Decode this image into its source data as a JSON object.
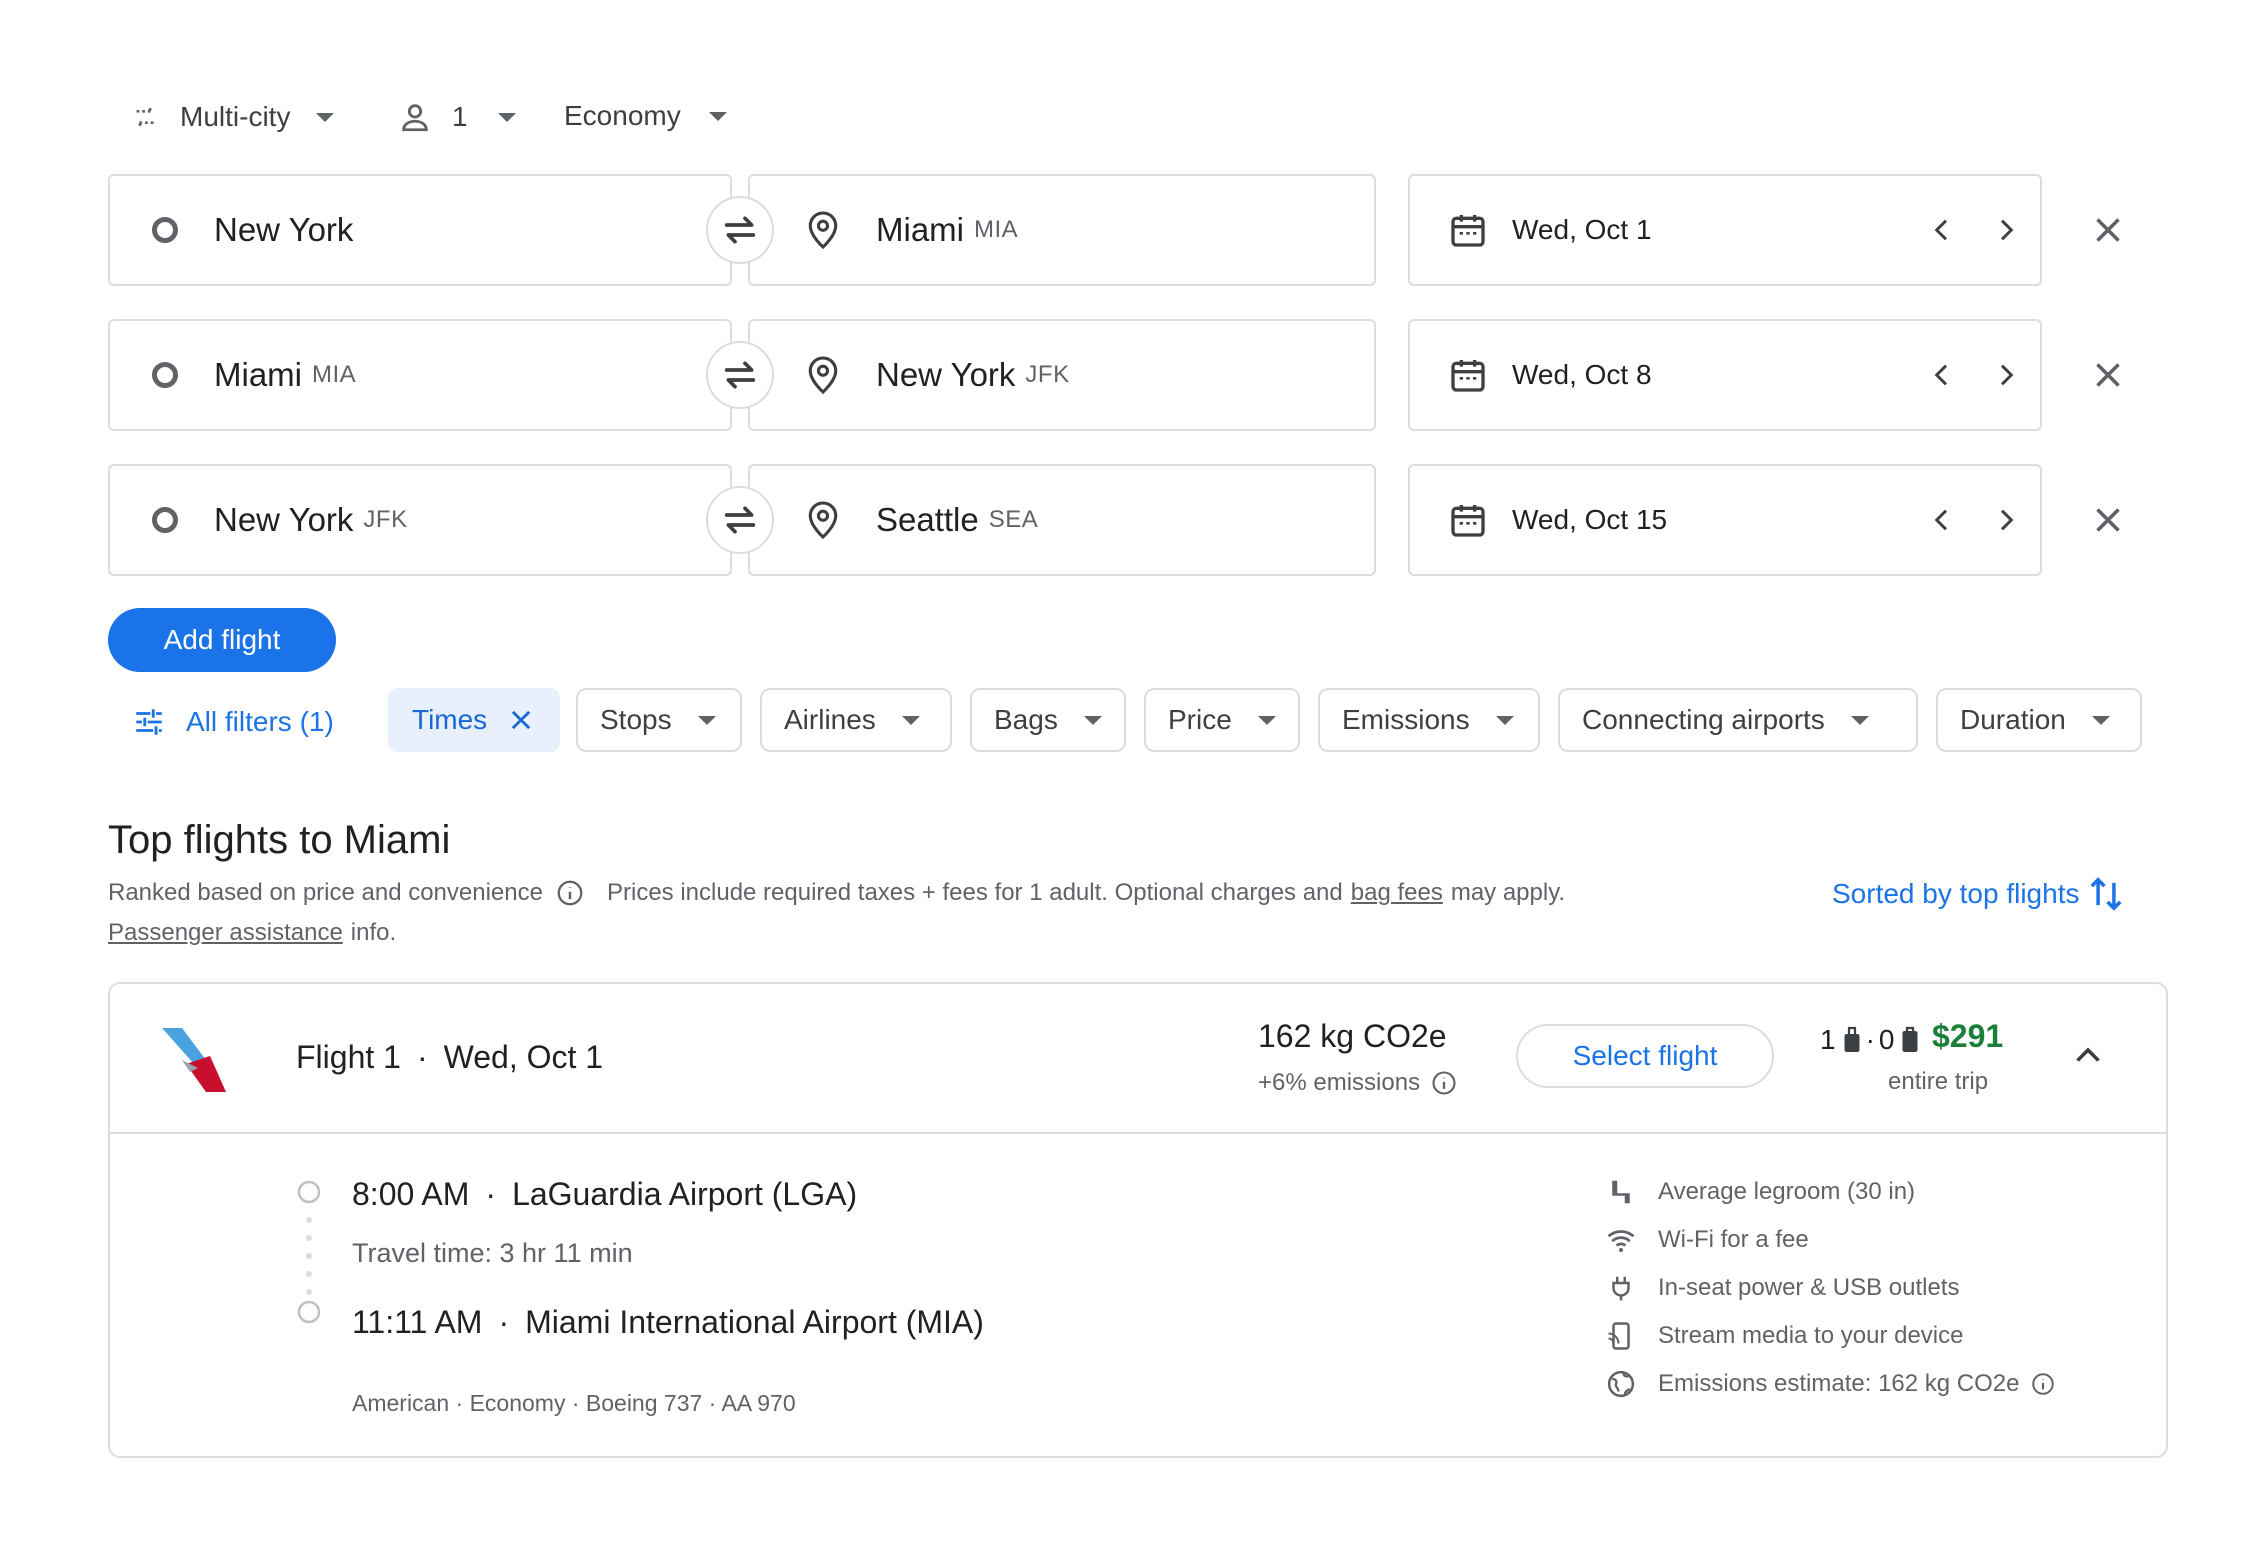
{
  "trip": {
    "type_label": "Multi-city",
    "passengers": "1",
    "cabin": "Economy"
  },
  "legs": [
    {
      "from_city": "New York",
      "from_code": "",
      "to_city": "Miami",
      "to_code": "MIA",
      "date": "Wed, Oct 1"
    },
    {
      "from_city": "Miami",
      "from_code": "MIA",
      "to_city": "New York",
      "to_code": "JFK",
      "date": "Wed, Oct 8"
    },
    {
      "from_city": "New York",
      "from_code": "JFK",
      "to_city": "Seattle",
      "to_code": "SEA",
      "date": "Wed, Oct 15"
    }
  ],
  "add_flight_label": "Add flight",
  "filters": {
    "all_label": "All filters (1)",
    "chips": [
      "Times",
      "Stops",
      "Airlines",
      "Bags",
      "Price",
      "Emissions",
      "Connecting airports",
      "Duration"
    ]
  },
  "results": {
    "title": "Top flights to Miami",
    "ranked_text": "Ranked based on price and convenience",
    "prices_text_before": "Prices include required taxes + fees for 1 adult. Optional charges and",
    "bag_fees_link": "bag fees",
    "prices_text_after": "may apply.",
    "passenger_link": "Passenger assistance",
    "passenger_after": "info.",
    "sorted_label": "Sorted by top flights"
  },
  "flight": {
    "label": "Flight 1",
    "date": "Wed, Oct 1",
    "emissions": "162 kg CO2e",
    "emissions_delta": "+6% emissions",
    "select_label": "Select flight",
    "carry_on_count": "1",
    "checked_count": "0",
    "price": "$291",
    "price_note": "entire trip",
    "depart_time": "8:00 AM",
    "depart_airport": "LaGuardia Airport (LGA)",
    "travel_time": "Travel time: 3 hr 11 min",
    "arrive_time": "11:11 AM",
    "arrive_airport": "Miami International Airport (MIA)",
    "details": "American · Economy · Boeing 737 · AA 970",
    "amenities": [
      "Average legroom (30 in)",
      "Wi-Fi for a fee",
      "In-seat power & USB outlets",
      "Stream media to your device",
      "Emissions estimate: 162 kg CO2e"
    ],
    "colors": {
      "price": "#188038",
      "accent": "#1a73e8",
      "airline_blue": "#4aa3df",
      "airline_red": "#c8102e"
    }
  }
}
